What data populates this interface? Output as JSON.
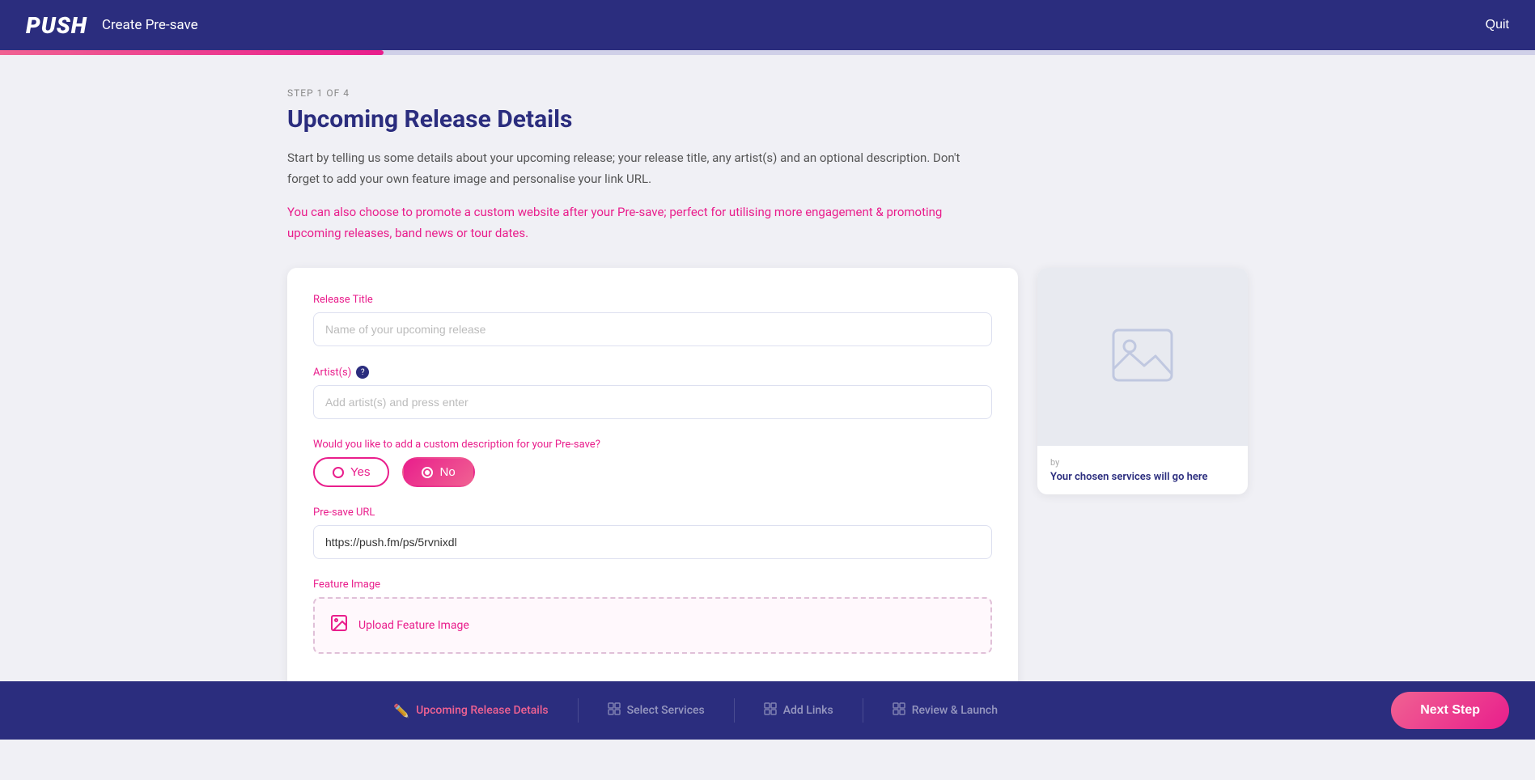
{
  "header": {
    "logo": "PUSH",
    "title": "Create Pre-save",
    "quit_label": "Quit"
  },
  "progress": {
    "percent": 25,
    "step_current": 1,
    "step_total": 4
  },
  "page": {
    "step_label": "STEP 1 OF 4",
    "title": "Upcoming Release Details",
    "description1": "Start by telling us some details about your upcoming release; your release title, any artist(s) and an optional description. Don't forget to add your own feature image and personalise your link URL.",
    "description2": "You can also choose to promote a custom website after your Pre-save; perfect for utilising more engagement & promoting upcoming releases, band news or tour dates."
  },
  "form": {
    "release_title_label": "Release Title",
    "release_title_placeholder": "Name of your upcoming release",
    "artists_label": "Artist(s)",
    "artists_placeholder": "Add artist(s) and press enter",
    "custom_desc_label": "Would you like to add a custom description for your Pre-save?",
    "yes_label": "Yes",
    "no_label": "No",
    "presave_url_label": "Pre-save URL",
    "presave_url_value": "https://push.fm/ps/5rvnixdl",
    "feature_image_label": "Feature Image",
    "upload_label": "Upload Feature Image"
  },
  "preview": {
    "by_label": "by",
    "services_label": "Your chosen services will go here"
  },
  "bottom_bar": {
    "steps": [
      {
        "id": "upcoming-release",
        "label": "Upcoming Release Details",
        "icon": "✏️",
        "active": true
      },
      {
        "id": "select-services",
        "label": "Select Services",
        "icon": "⊞",
        "active": false
      },
      {
        "id": "add-links",
        "label": "Add Links",
        "icon": "⊞",
        "active": false
      },
      {
        "id": "review-launch",
        "label": "Review & Launch",
        "icon": "⊞",
        "active": false
      }
    ],
    "next_label": "Next Step"
  }
}
